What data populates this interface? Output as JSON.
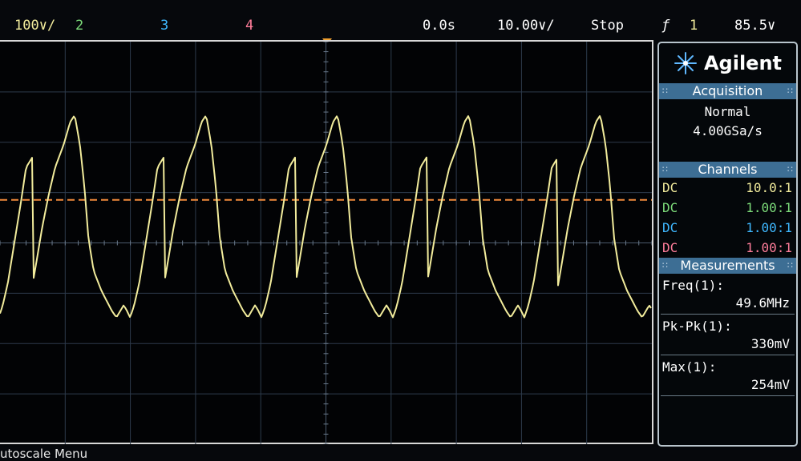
{
  "status_bar": {
    "ch1_scale": "100∨/",
    "ch2_label": "2",
    "ch3_label": "3",
    "ch4_label": "4",
    "time_delay": "0.0s",
    "time_scale": "10.00∨/",
    "run_state": "Stop",
    "trigger_slope_symbol": "ƒ",
    "trigger_source": "1",
    "trigger_level": "85.5∨"
  },
  "colors": {
    "ch1": "#f2ec9c",
    "ch2": "#7ddc7a",
    "ch3": "#3fb8ff",
    "ch4": "#ff7d9a",
    "trigger_level_line": "#f08a3c",
    "panel_header": "#3d6e94"
  },
  "brand": {
    "name": "Agilent",
    "logo_icon": "agilent-spark-icon"
  },
  "acquisition": {
    "title": "Acquisition",
    "mode": "Normal",
    "sample_rate": "4.00GSa/s"
  },
  "channels": {
    "title": "Channels",
    "rows": [
      {
        "coupling": "DC",
        "probe": "10.0:1"
      },
      {
        "coupling": "DC",
        "probe": "1.00:1"
      },
      {
        "coupling": "DC",
        "probe": "1.00:1"
      },
      {
        "coupling": "DC",
        "probe": "1.00:1"
      }
    ]
  },
  "measurements": {
    "title": "Measurements",
    "items": [
      {
        "label": "Freq(1):",
        "value": "49.6MHz"
      },
      {
        "label": "Pk-Pk(1):",
        "value": "330mV"
      },
      {
        "label": "Max(1):",
        "value": "254mV"
      }
    ]
  },
  "softkey": {
    "label": "utoscale Menu"
  },
  "waveform": {
    "ch1": {
      "cycle_ns": 20.16,
      "volts_per_div": 0.1,
      "ns_per_div": 10,
      "trigger_level_mv": 85.5,
      "shape_mv": [
        [
          0,
          -85
        ],
        [
          0.6,
          -40
        ],
        [
          1.5,
          30
        ],
        [
          2.5,
          95
        ],
        [
          3.5,
          150
        ],
        [
          4.8,
          195
        ],
        [
          5.8,
          240
        ],
        [
          6.5,
          254
        ],
        [
          7.3,
          195
        ],
        [
          8.0,
          110
        ],
        [
          8.6,
          10
        ],
        [
          9.4,
          -55
        ],
        [
          10.6,
          -95
        ],
        [
          11.6,
          -120
        ],
        [
          12.2,
          -135
        ],
        [
          12.9,
          -148
        ],
        [
          13.5,
          -135
        ],
        [
          14.0,
          -124
        ],
        [
          14.4,
          -132
        ],
        [
          15.0,
          -148
        ],
        [
          15.6,
          -125
        ],
        [
          16.4,
          -80
        ],
        [
          17.4,
          0
        ],
        [
          18.4,
          80
        ],
        [
          19.2,
          150
        ],
        [
          20.16,
          170
        ]
      ],
      "start_phase_ns": 15.2
    }
  }
}
